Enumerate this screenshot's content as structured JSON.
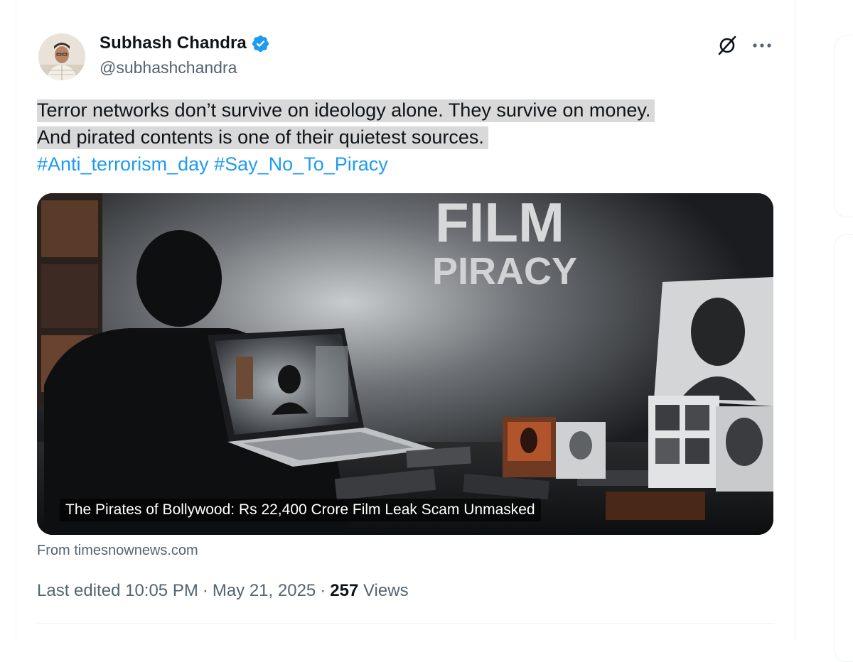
{
  "author": {
    "name": "Subhash Chandra",
    "handle": "@subhashchandra",
    "verified": true,
    "avatar_icon": "profile-photo-avatar"
  },
  "tweet": {
    "line1": "Terror networks don’t survive on ideology alone. They survive on money.",
    "line2": "And pirated contents is one of their quietest sources.",
    "hashtags": [
      "#Anti_terrorism_day",
      "#Say_No_To_Piracy"
    ]
  },
  "media": {
    "image_text_line1": "FILM",
    "image_text_line2": "PIRACY",
    "caption": "The Pirates of Bollywood: Rs 22,400 Crore Film Leak Scam Unmasked",
    "source": "From timesnownews.com"
  },
  "meta": {
    "edited_prefix": "Last edited",
    "time": "10:05 PM",
    "date": "May 21, 2025",
    "views_count": "257",
    "views_label": "Views"
  },
  "icons": {
    "grok": "grok-icon",
    "more": "more-icon",
    "verified": "verified-badge-icon"
  },
  "colors": {
    "accent": "#1d9bf0",
    "secondary_text": "#536471",
    "highlight": "#d9d9d9"
  }
}
